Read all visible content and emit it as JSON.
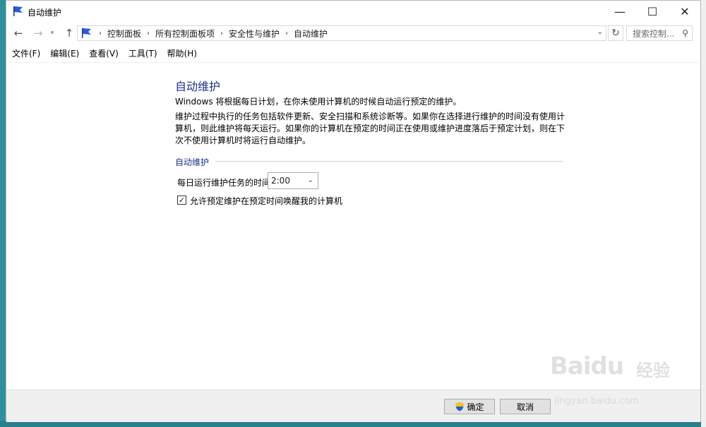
{
  "window": {
    "title": "自动维护",
    "controls": {
      "minimize": "—",
      "maximize": "☐",
      "close": "✕"
    }
  },
  "nav": {
    "breadcrumbs": [
      "控制面板",
      "所有控制面板项",
      "安全性与维护",
      "自动维护"
    ],
    "search_placeholder": "搜索控制..."
  },
  "menu": [
    "文件(F)",
    "编辑(E)",
    "查看(V)",
    "工具(T)",
    "帮助(H)"
  ],
  "content": {
    "title": "自动维护",
    "intro": "Windows 将根据每日计划，在你未使用计算机的时候自动运行预定的维护。",
    "description": "维护过程中执行的任务包括软件更新、安全扫描和系统诊断等。如果你在选择进行维护的时间没有使用计算机，则此维护将每天运行。如果你的计算机在预定的时间正在使用或维护进度落后于预定计划，则在下次不使用计算机时将运行自动维护。",
    "group_title": "自动维护",
    "time_label": "每日运行维护任务的时间",
    "time_value": "2:00",
    "wake_label": "允许预定维护在预定时间唤醒我的计算机",
    "wake_checked": true
  },
  "footer": {
    "ok_label": "确定",
    "cancel_label": "取消"
  },
  "watermark": {
    "brand": "Baidu",
    "cn": "经验",
    "url": "jingyan.baidu.com"
  },
  "colors": {
    "accent": "#1e3287",
    "desktop": "#2f8f9d"
  }
}
